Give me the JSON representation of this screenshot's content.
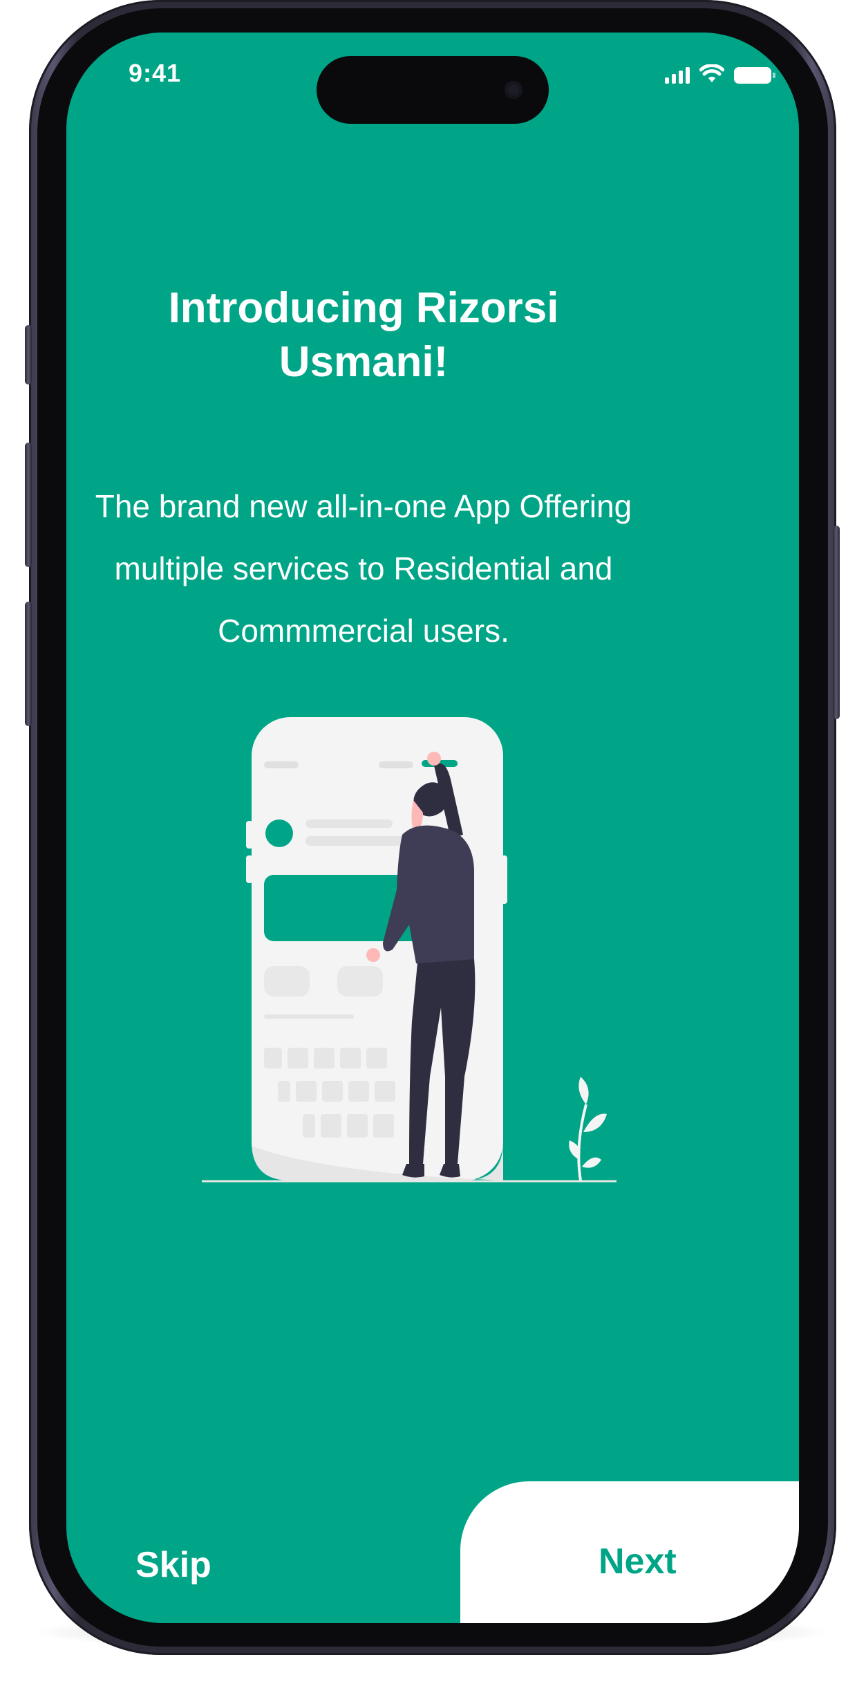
{
  "status_bar": {
    "time": "9:41",
    "icons": [
      "signal-icon",
      "wifi-icon",
      "battery-icon"
    ]
  },
  "onboarding": {
    "title": "Introducing Rizorsi Usmani!",
    "description": "The brand new all-in-one App Offering multiple services to Residential and Commmercial users.",
    "illustration": "person-using-phone-illustration"
  },
  "navigation": {
    "skip_label": "Skip",
    "next_label": "Next"
  },
  "colors": {
    "accent": "#00a587",
    "text_on_accent": "#ffffff",
    "button_bg": "#ffffff",
    "illustration_dark": "#3f3d56"
  }
}
